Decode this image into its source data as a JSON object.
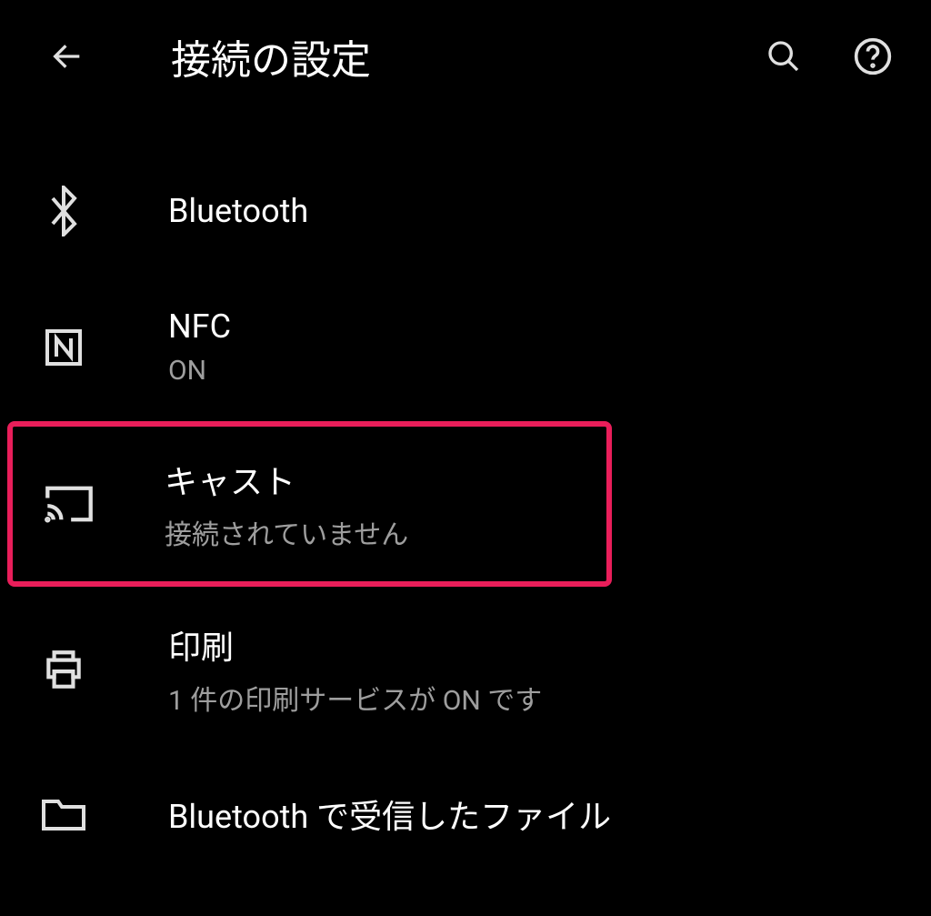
{
  "header": {
    "title": "接続の設定"
  },
  "items": [
    {
      "title": "Bluetooth",
      "subtitle": ""
    },
    {
      "title": "NFC",
      "subtitle": "ON"
    },
    {
      "title": "キャスト",
      "subtitle": "接続されていません"
    },
    {
      "title": "印刷",
      "subtitle": "1 件の印刷サービスが ON です"
    },
    {
      "title": "Bluetooth で受信したファイル",
      "subtitle": ""
    }
  ]
}
